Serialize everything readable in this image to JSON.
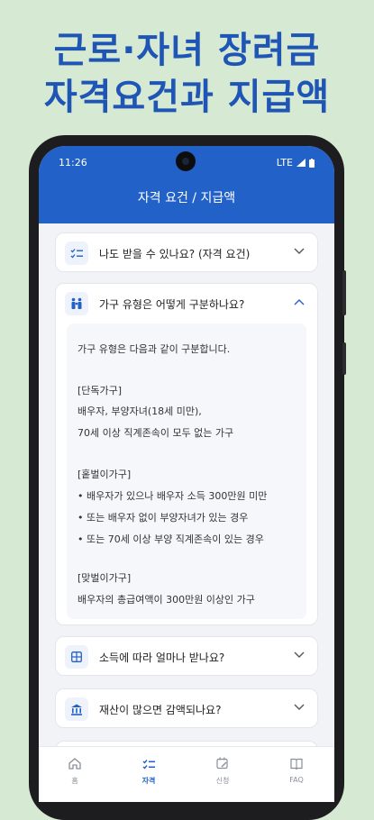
{
  "promo": {
    "line1": "근로·자녀 장려금",
    "line2": "자격요건과 지급액"
  },
  "statusbar": {
    "time": "11:26",
    "network": "LTE"
  },
  "appbar": {
    "title": "자격 요건 / 지급액"
  },
  "faq": [
    {
      "title": "나도 받을 수 있나요? (자격 요건)",
      "icon": "checklist-icon",
      "expanded": false
    },
    {
      "title": "가구 유형은 어떻게 구분하나요?",
      "icon": "family-icon",
      "expanded": true,
      "answer": [
        "가구 유형은 다음과 같이 구분합니다.",
        "[단독가구]",
        "배우자, 부양자녀(18세 미만),",
        "70세 이상 직계존속이 모두 없는 가구",
        "[홑벌이가구]",
        "• 배우자가 있으나 배우자 소득 300만원 미만",
        "• 또는 배우자 없이 부양자녀가 있는 경우",
        "• 또는 70세 이상 부양 직계존속이 있는 경우",
        "[맞벌이가구]",
        "배우자의 총급여액이 300만원 이상인 가구"
      ]
    },
    {
      "title": "소득에 따라 얼마나 받나요?",
      "icon": "calculator-icon",
      "expanded": false
    },
    {
      "title": "재산이 많으면 감액되나요?",
      "icon": "bank-icon",
      "expanded": false
    }
  ],
  "bottomnav": [
    {
      "label": "홈",
      "icon": "home-icon",
      "active": false
    },
    {
      "label": "자격",
      "icon": "checklist-icon",
      "active": true
    },
    {
      "label": "신청",
      "icon": "calendar-edit-icon",
      "active": false
    },
    {
      "label": "FAQ",
      "icon": "book-icon",
      "active": false
    }
  ],
  "colors": {
    "primary": "#2261c7",
    "background": "#d6e9d2"
  }
}
